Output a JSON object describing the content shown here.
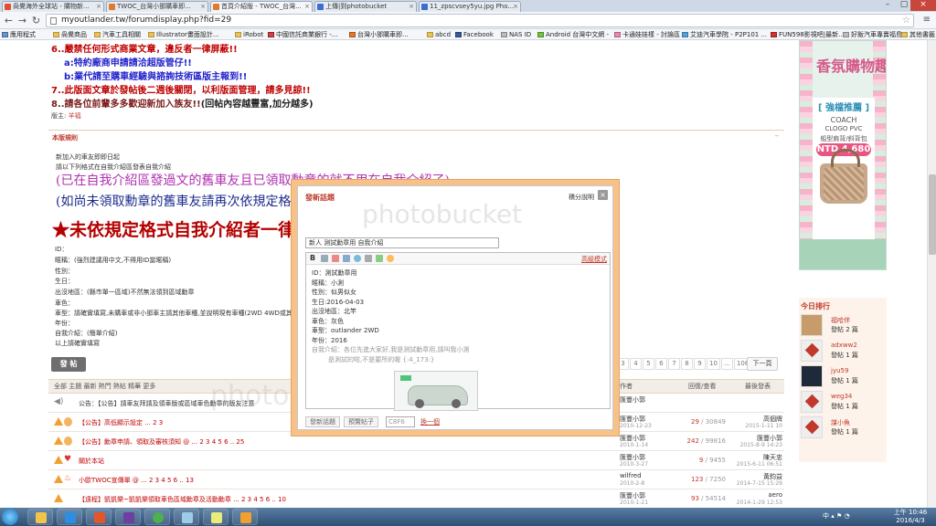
{
  "browser": {
    "tabs": [
      {
        "label": "咼覺海外全球站 - 購物新..."
      },
      {
        "label": "TWOC_台灣小鄧購車即..."
      },
      {
        "label": "首頁介紹版 - TWOC_台灣..."
      },
      {
        "label": "上傳|到photobucket"
      },
      {
        "label": "11_zpscvsey5yu.jpg Pho..."
      }
    ],
    "url": "myoutlander.tw/forumdisplay.php?fid=29",
    "bookmarks": [
      "應用程式",
      "咼覺商品",
      "汽車工具相關",
      "Illustrator畫面設計...",
      "iRobot",
      "中國信託商業銀行 -...",
      "台灣小鄧購車即...",
      "abcd",
      "Facebook",
      "NAS ID",
      "Android 台灣中文網 -",
      "卡通娃娃樣 - 討論區 -",
      "艾迪汽車學院 - P2P101 ...",
      "FUN598影視吧|最新...",
      "好飯汽車專賣福島",
      "其他書籤"
    ]
  },
  "rules": [
    {
      "text": "6..嚴禁任何形式商業文章，違反者一律屏蔽!!",
      "color": "red"
    },
    {
      "text": "a:特約廠商申請請洽超版管仔!!",
      "color": "blue"
    },
    {
      "text": "b:業代請至購車經驗與諮詢技術區版主報到!!",
      "color": "blue"
    },
    {
      "text": "7..此版面文章於發帖後二週後關閉，以利版面管理，請多見諒!!",
      "color": "red"
    },
    {
      "text": "8..請各位前輩多多歡迎新加入族友!!",
      "color": "maroon"
    },
    {
      "text": "(回帖內容越豐富,加分越多)",
      "color": "dark"
    }
  ],
  "moderator": {
    "label": "版主:",
    "name": "羊福"
  },
  "section": {
    "title": "本版規則",
    "line1": "新加入的車友即即日起",
    "line2": "請以下列格式在自我介紹區發表自我介紹",
    "note1": "(已在自我介紹區發過文的舊車友且已領取勳章的就不用在自我介紹了)",
    "note2": "(如尚未領取勳章的舊車友請再次依規定格式自我介紹)",
    "warning": "★未依規定格式自我介紹者一律",
    "form": [
      "ID：",
      "暱稱：(強烈建議用中文,不得用ID當暱稱)",
      "性別：",
      "生日：",
      "出沒地區：(縣市單一區域)不然無法領到區域勳章",
      "車色：",
      "車型：請確實填寫,未購車或非小鄧車主請其他車種,並說明現有車種(2WD 4WD或其",
      "年份：",
      "自我介紹：(簡單介紹)",
      "以上請確實填寫"
    ]
  },
  "post_button": "發 帖",
  "pager": {
    "pages": [
      "3",
      "4",
      "5",
      "6",
      "7",
      "8",
      "9",
      "10",
      "...",
      "106"
    ],
    "next": "下一頁"
  },
  "list_header": {
    "filter": "全部  主題  最新  熱門  熱帖  精華  更多",
    "col_author": "作者",
    "col_replies": "回復/查看",
    "col_last": "最後發表"
  },
  "threads": [
    {
      "title": "公告：【公告】請車友拜請及領車版或區域車色勳章的版友注意",
      "author": "匯豐小郭",
      "date": "",
      "replies": "",
      "views": "",
      "last": "",
      "ldate": "",
      "red": false,
      "icon": "speaker"
    },
    {
      "title": "【公告】高低顯示設定  ... 2 3",
      "author": "匯豐小郭",
      "date": "2010-12-23",
      "replies": "29",
      "views": "30849",
      "last": "高個牌",
      "ldate": "2015-1-11 10",
      "red": true,
      "icon": "pin"
    },
    {
      "title": "【公告】勳章申請、領取及審核須知 @ ... 2 3 4 5 6 .. 25",
      "author": "匯豐小郭",
      "date": "2010-1-14",
      "replies": "242",
      "views": "99816",
      "last": "匯豐小郭",
      "ldate": "2015-8-9 14:23",
      "red": true,
      "icon": "pin"
    },
    {
      "title": "關於本站",
      "author": "匯豐小郭",
      "date": "2010-3-27",
      "replies": "9",
      "views": "9455",
      "last": "陳天忠",
      "ldate": "2015-6-11 06:51",
      "red": true,
      "icon": "heart"
    },
    {
      "title": "小歐TWOC宣傳單 @ ... 2 3 4 5 6 .. 13",
      "author": "wilfred",
      "date": "2010-2-8",
      "replies": "123",
      "views": "7250",
      "last": "黃鈞益",
      "ldate": "2014-7-15 15:29",
      "red": true,
      "icon": "fire"
    },
    {
      "title": "【遠程】凱凱樂~凱凱樂領取車色區域勳章及活動勳章  ... 2 3 4 5 6 .. 10",
      "author": "匯豐小郭",
      "date": "2010-1-21",
      "replies": "93",
      "views": "54514",
      "last": "aero",
      "ldate": "2014-1-29 12:53",
      "red": true,
      "icon": "fire"
    }
  ],
  "ad": {
    "headline": "香氛購物趣",
    "tag": "[ 強檔推薦 ]",
    "brand": "COACH",
    "product": "CLOGO PVC",
    "sub": "船型肩背/斜背包",
    "price": "NTD 4,680"
  },
  "ranking": {
    "title": "今日排行",
    "items": [
      {
        "name": "福哈伴",
        "posts": "發帖 2 篇"
      },
      {
        "name": "adxww2",
        "posts": "發帖 1 篇"
      },
      {
        "name": "jyu59",
        "posts": "發帖 1 篇"
      },
      {
        "name": "weg34",
        "posts": "發帖 1 篇"
      },
      {
        "name": "謀小魚",
        "posts": "發帖 1 篇"
      }
    ]
  },
  "dialog": {
    "title": "發新話題",
    "help": "積分說明",
    "subject": "新人 測試勳章用 自我介紹",
    "advanced": "高級模式",
    "body": [
      "ID：測試勳章用",
      "暱稱：小測",
      "性別：似男似女",
      "生日:2016-04-03",
      "出沒地區：北竿",
      "車色：灰色",
      "車型：outlander 2WD",
      "年份：2016"
    ],
    "intro1": "自我介紹：各位先進大家好,我是測試勳章用,請叫我小測",
    "intro2": "是測試的啦,不是要所的喔 {:4_173:}",
    "btn_submit": "發新話題",
    "btn_cancel": "預覽帖子",
    "captcha": "C8F6",
    "refresh": "換一個",
    "watermark": "photobucket"
  },
  "taskbar": {
    "lang": "中",
    "time": "上午 10:46",
    "date": "2016/4/3"
  },
  "colors": {
    "accent": "#c0392b",
    "rule_red": "#c00000",
    "rule_blue": "#2222cc",
    "note_purple": "#b030b0",
    "dialog_frame": "#f6c28a"
  }
}
